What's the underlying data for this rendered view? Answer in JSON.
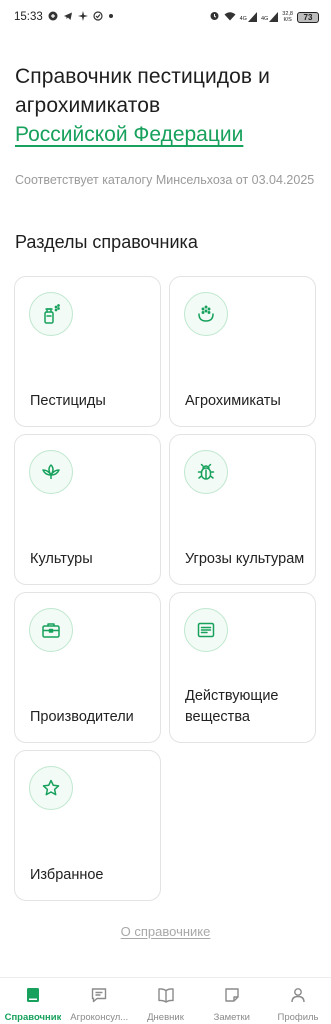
{
  "status_bar": {
    "time": "15:33",
    "speed_value": "32,8",
    "speed_unit": "К/S",
    "battery": "73",
    "net1": "4G",
    "net2": "4G"
  },
  "header": {
    "title": "Справочник пестицидов и агрохимикатов",
    "title_accent": "Российской Федерации",
    "subtitle": "Соответствует каталогу Минсельхоза от 03.04.2025"
  },
  "sections": {
    "title": "Разделы справочника",
    "cards": [
      {
        "label": "Пестициды",
        "icon": "spray-bottle-icon"
      },
      {
        "label": "Агрохимикаты",
        "icon": "fertilizer-icon"
      },
      {
        "label": "Культуры",
        "icon": "plant-icon"
      },
      {
        "label": "Угрозы культурам",
        "icon": "bug-icon"
      },
      {
        "label": "Производители",
        "icon": "briefcase-icon"
      },
      {
        "label": "Действующие вещества",
        "icon": "document-icon"
      },
      {
        "label": "Избранное",
        "icon": "star-icon"
      }
    ]
  },
  "about_link": "О справочнике",
  "bottom_nav": [
    {
      "label": "Справочник",
      "icon": "book-icon",
      "active": true
    },
    {
      "label": "Агроконсул...",
      "icon": "chat-icon",
      "active": false
    },
    {
      "label": "Дневник",
      "icon": "open-book-icon",
      "active": false
    },
    {
      "label": "Заметки",
      "icon": "note-icon",
      "active": false
    },
    {
      "label": "Профиль",
      "icon": "user-icon",
      "active": false
    }
  ],
  "colors": {
    "accent": "#17a15c",
    "muted_text": "#9a9a9a",
    "card_border": "#e3e3e3"
  }
}
